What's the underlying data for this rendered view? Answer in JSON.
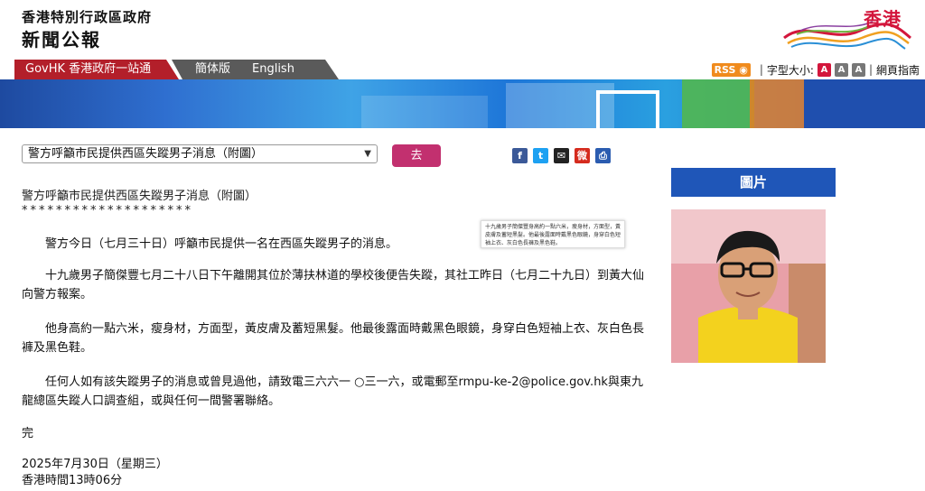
{
  "header": {
    "gov_name": "香港特別行政區政府",
    "site_name": "新聞公報",
    "brand_text": "香港"
  },
  "nav": {
    "govhk": "GovHK 香港政府一站通",
    "simplified": "簡体版",
    "english": "English",
    "rss": "RSS",
    "font_size_label": "字型大小:",
    "font_sizes": [
      "A",
      "A",
      "A"
    ],
    "font_size_colors": [
      "#d3163c",
      "#777777",
      "#777777"
    ],
    "sitemap": "網頁指南"
  },
  "selector": {
    "selected": "警方呼籲市民提供西區失蹤男子消息（附圖）",
    "go_label": "去"
  },
  "share_icons": [
    {
      "name": "facebook-icon",
      "glyph": "f",
      "color": "#3b5998"
    },
    {
      "name": "twitter-icon",
      "glyph": "t",
      "color": "#1da1f2"
    },
    {
      "name": "email-icon",
      "glyph": "✉",
      "color": "#222222"
    },
    {
      "name": "weibo-icon",
      "glyph": "微",
      "color": "#d52b1e"
    },
    {
      "name": "print-icon",
      "glyph": "⎙",
      "color": "#2b5cb0"
    }
  ],
  "article": {
    "title": "警方呼籲市民提供西區失蹤男子消息（附圖）",
    "stars": "********************",
    "p1": "　　警方今日（七月三十日）呼籲市民提供一名在西區失蹤男子的消息。",
    "p2": "　　十九歲男子簡傑豐七月二十八日下午離開其位於薄扶林道的學校後便告失蹤，其社工昨日（七月二十九日）到黃大仙向警方報案。",
    "p3": "　　他身高約一點六米，瘦身材，方面型，黃皮膚及蓄短黑髮。他最後露面時戴黑色眼鏡，身穿白色短袖上衣、灰白色長褲及黑色鞋。",
    "p4": "　　任何人如有該失蹤男子的消息或曾見過他，請致電三六六一 ○三一六，或電郵至rmpu-ke-2@police.gov.hk與東九龍總區失蹤人口調查組，或與任何一間警署聯絡。",
    "end": "完",
    "date": "2025年7月30日（星期三）",
    "time": "香港時間13時06分"
  },
  "tooltip": "十九歲男子簡傑豐身高約一點六米，瘦身材，方面型，黃皮膚及蓄短黑髮。他最後露面時戴黑色眼鏡，身穿白色短袖上衣、灰白色長褲及黑色鞋。",
  "photo_panel": {
    "heading": "圖片"
  }
}
